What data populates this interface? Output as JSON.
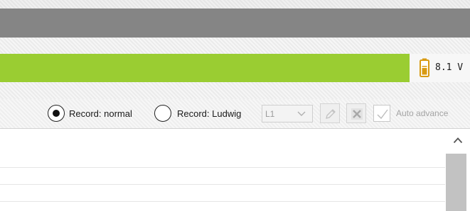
{
  "status_bar": {
    "voltage": "8.1 V",
    "battery_level": 0.5,
    "status_color": "#9acd32"
  },
  "toolbar": {
    "record_normal": {
      "label": "Record: normal",
      "selected": true
    },
    "record_ludwig": {
      "label": "Record: Ludwig",
      "selected": false
    },
    "lead_select": {
      "value": "L1"
    },
    "edit_button": {
      "icon": "pencil-icon",
      "enabled": false
    },
    "delete_button": {
      "icon": "close-icon",
      "enabled": false
    },
    "auto_advance": {
      "label": "Auto advance",
      "checked": true,
      "enabled": false
    }
  },
  "list": {
    "rows": [
      "",
      "",
      ""
    ]
  },
  "scrollbar": {
    "up_icon": "chevron-up-icon"
  }
}
